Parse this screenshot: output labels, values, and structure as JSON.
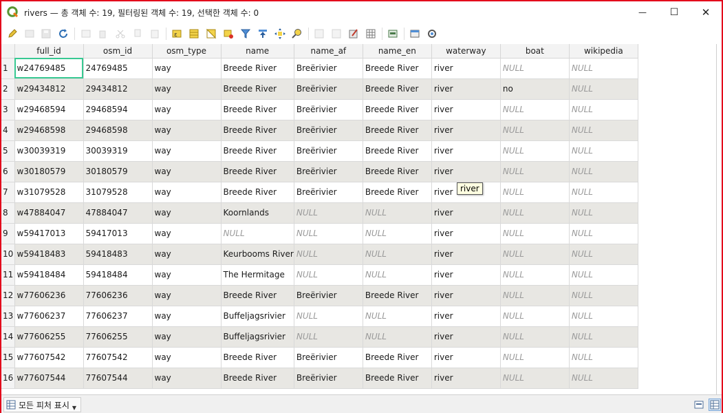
{
  "window": {
    "title": "rivers — 총 객체 수: 19, 필터링된 객체 수: 19, 선택한 객체 수: 0",
    "minimize_glyph": "—",
    "maximize_glyph": "☐",
    "close_glyph": "✕"
  },
  "colors": {
    "frame_border": "#e3001b",
    "selection_outline": "#38c992",
    "alt_row": "#e8e7e3",
    "null_text": "#9a9a9a"
  },
  "toolbar": {
    "icons": [
      "edit-pencil-icon",
      "multi-edit-icon",
      "save-edits-icon",
      "reload-icon",
      "add-feature-icon",
      "delete-feature-icon",
      "cut-icon",
      "copy-icon",
      "paste-icon",
      "select-expression-icon",
      "select-all-icon",
      "invert-selection-icon",
      "deselect-icon",
      "filter-select-icon",
      "move-selection-top-icon",
      "pan-to-selection-icon",
      "zoom-to-selection-icon",
      "new-field-icon",
      "delete-field-icon",
      "field-calculator-icon",
      "conditional-format-icon",
      "dock-icon",
      "actions-icon",
      "form-view-icon"
    ]
  },
  "table": {
    "columns": [
      "full_id",
      "osm_id",
      "osm_type",
      "name",
      "name_af",
      "name_en",
      "waterway",
      "boat",
      "wikipedia"
    ],
    "rows": [
      [
        "1",
        "w24769485",
        "24769485",
        "way",
        "Breede River",
        "Breërivier",
        "Breede River",
        "river",
        "NULL",
        "NULL"
      ],
      [
        "2",
        "w29434812",
        "29434812",
        "way",
        "Breede River",
        "Breërivier",
        "Breede River",
        "river",
        "no",
        "NULL"
      ],
      [
        "3",
        "w29468594",
        "29468594",
        "way",
        "Breede River",
        "Breërivier",
        "Breede River",
        "river",
        "NULL",
        "NULL"
      ],
      [
        "4",
        "w29468598",
        "29468598",
        "way",
        "Breede River",
        "Breërivier",
        "Breede River",
        "river",
        "NULL",
        "NULL"
      ],
      [
        "5",
        "w30039319",
        "30039319",
        "way",
        "Breede River",
        "Breërivier",
        "Breede River",
        "river",
        "NULL",
        "NULL"
      ],
      [
        "6",
        "w30180579",
        "30180579",
        "way",
        "Breede River",
        "Breërivier",
        "Breede River",
        "river",
        "NULL",
        "NULL"
      ],
      [
        "7",
        "w31079528",
        "31079528",
        "way",
        "Breede River",
        "Breërivier",
        "Breede River",
        "river",
        "NULL",
        "NULL"
      ],
      [
        "8",
        "w47884047",
        "47884047",
        "way",
        "Koornlands",
        "NULL",
        "NULL",
        "river",
        "NULL",
        "NULL"
      ],
      [
        "9",
        "w59417013",
        "59417013",
        "way",
        "NULL",
        "NULL",
        "NULL",
        "river",
        "NULL",
        "NULL"
      ],
      [
        "10",
        "w59418483",
        "59418483",
        "way",
        "Keurbooms River",
        "NULL",
        "NULL",
        "river",
        "NULL",
        "NULL"
      ],
      [
        "11",
        "w59418484",
        "59418484",
        "way",
        "The Hermitage",
        "NULL",
        "NULL",
        "river",
        "NULL",
        "NULL"
      ],
      [
        "12",
        "w77606236",
        "77606236",
        "way",
        "Breede River",
        "Breërivier",
        "Breede River",
        "river",
        "NULL",
        "NULL"
      ],
      [
        "13",
        "w77606237",
        "77606237",
        "way",
        "Buffeljagsrivier",
        "NULL",
        "NULL",
        "river",
        "NULL",
        "NULL"
      ],
      [
        "14",
        "w77606255",
        "77606255",
        "way",
        "Buffeljagsrivier",
        "NULL",
        "NULL",
        "river",
        "NULL",
        "NULL"
      ],
      [
        "15",
        "w77607542",
        "77607542",
        "way",
        "Breede River",
        "Breërivier",
        "Breede River",
        "river",
        "NULL",
        "NULL"
      ],
      [
        "16",
        "w77607544",
        "77607544",
        "way",
        "Breede River",
        "Breërivier",
        "Breede River",
        "river",
        "NULL",
        "NULL"
      ]
    ],
    "null_label": "NULL"
  },
  "tooltip": {
    "text": "river"
  },
  "statusbar": {
    "filter_label": "모든 피처 표시",
    "view_icons": [
      "form-view-icon",
      "table-view-icon"
    ]
  }
}
